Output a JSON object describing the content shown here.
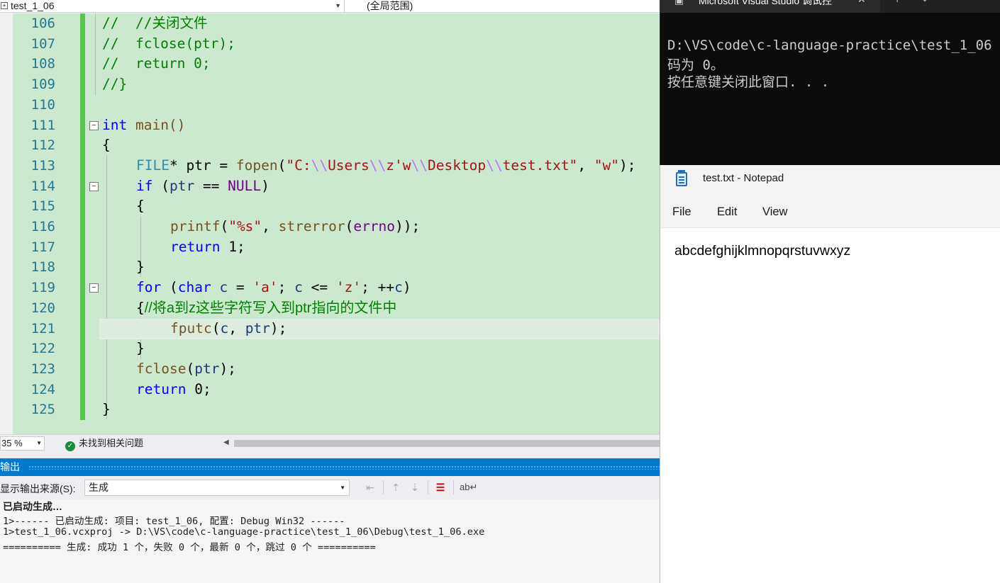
{
  "vs": {
    "file_combo": "test_1_06",
    "scope_combo": "(全局范围)",
    "zoom": "35 %",
    "issues": "未找到相关问题",
    "output": {
      "title": "输出",
      "source_label": "显示输出来源(S):",
      "source_value": "生成",
      "lines": [
        "已启动生成…",
        "1>------ 已启动生成: 项目: test_1_06, 配置: Debug Win32 ------",
        "1>test_1_06.vcxproj -> D:\\VS\\code\\c-language-practice\\test_1_06\\Debug\\test_1_06.exe",
        "========== 生成: 成功 1 个，失败 0 个，最新 0 个，跳过 0 个 =========="
      ]
    },
    "line_numbers": [
      "106",
      "107",
      "108",
      "109",
      "110",
      "111",
      "112",
      "113",
      "114",
      "115",
      "116",
      "117",
      "118",
      "119",
      "120",
      "121",
      "122",
      "123",
      "124",
      "125"
    ],
    "code_text": {
      "l106": "//  //关闭文件",
      "l107": "//  fclose(ptr);",
      "l108": "//  return 0;",
      "l109": "//}",
      "l111_kw": "int",
      "l111_rest": " main()",
      "l112": "{",
      "l113_type": "FILE",
      "l113_a": "* ptr = ",
      "l113_fn": "fopen",
      "l113_s1": "\"C:",
      "l113_e1": "\\\\",
      "l113_s2": "Users",
      "l113_e2": "\\\\",
      "l113_s3": "z'w",
      "l113_e3": "\\\\",
      "l113_s4": "Desktop",
      "l113_e4": "\\\\",
      "l113_s5": "test.txt\"",
      "l113_s6": "\"w\"",
      "l114_kw": "if",
      "l114_var": "ptr",
      "l114_mc": "NULL",
      "l115": "{",
      "l116_fn": "printf",
      "l116_str": "\"%s\"",
      "l116_fn2": "strerror",
      "l116_mc": "errno",
      "l117_kw": "return",
      "l117_num": "1",
      "l118": "}",
      "l119_kw": "for",
      "l119_kw2": "char",
      "l119_v": "c",
      "l119_s1": "'a'",
      "l119_s2": "'z'",
      "l120_br": "{",
      "l120_cm": "//将a到z这些字符写入到ptr指向的文件中",
      "l121_fn": "fputc",
      "l121_v1": "c",
      "l121_v2": "ptr",
      "l122": "}",
      "l123_fn": "fclose",
      "l123_v": "ptr",
      "l124_kw": "return",
      "l124_num": "0",
      "l125": "}"
    }
  },
  "console": {
    "title": "Microsoft Visual Studio 调试控",
    "lines": [
      "D:\\VS\\code\\c-language-practice\\test_1_06",
      "码为 0。",
      "按任意键关闭此窗口. . ."
    ]
  },
  "notepad": {
    "title": "test.txt - Notepad",
    "menu": [
      "File",
      "Edit",
      "View"
    ],
    "content": "abcdefghijklmnopqrstuvwxyz"
  },
  "colors": {
    "editor_bg": "#cce8cf",
    "output_header": "#007acc",
    "console_bg": "#0c0c0c"
  }
}
